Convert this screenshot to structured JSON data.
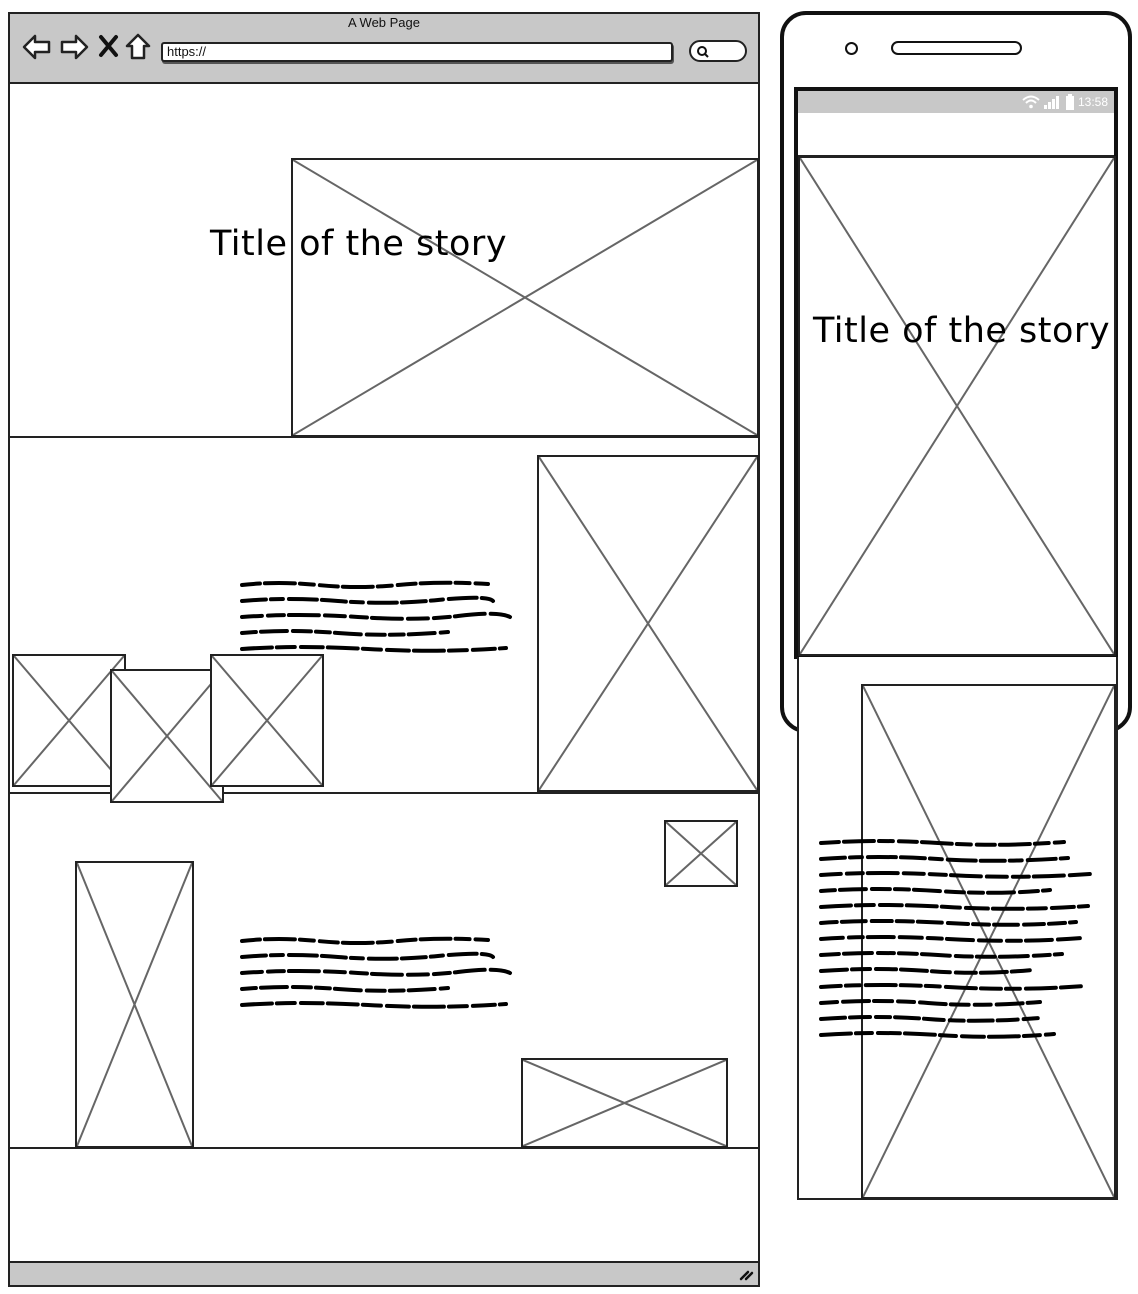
{
  "browser": {
    "window_title": "A Web Page",
    "url": "https://",
    "nav_icons": [
      "back-arrow-icon",
      "forward-arrow-icon",
      "close-x-icon",
      "home-icon"
    ],
    "search_icon": "search-icon",
    "resize_icon": "resize-grip-icon"
  },
  "desktop": {
    "hero_title": "Title of the story"
  },
  "mobile": {
    "status_time": "13:58",
    "status_icons": [
      "wifi-icon",
      "signal-icon",
      "battery-icon"
    ],
    "hero_title": "Title of the story"
  },
  "colors": {
    "chrome": "#c8c8c8",
    "stroke": "#222222",
    "placeholder_cross": "#666666"
  }
}
